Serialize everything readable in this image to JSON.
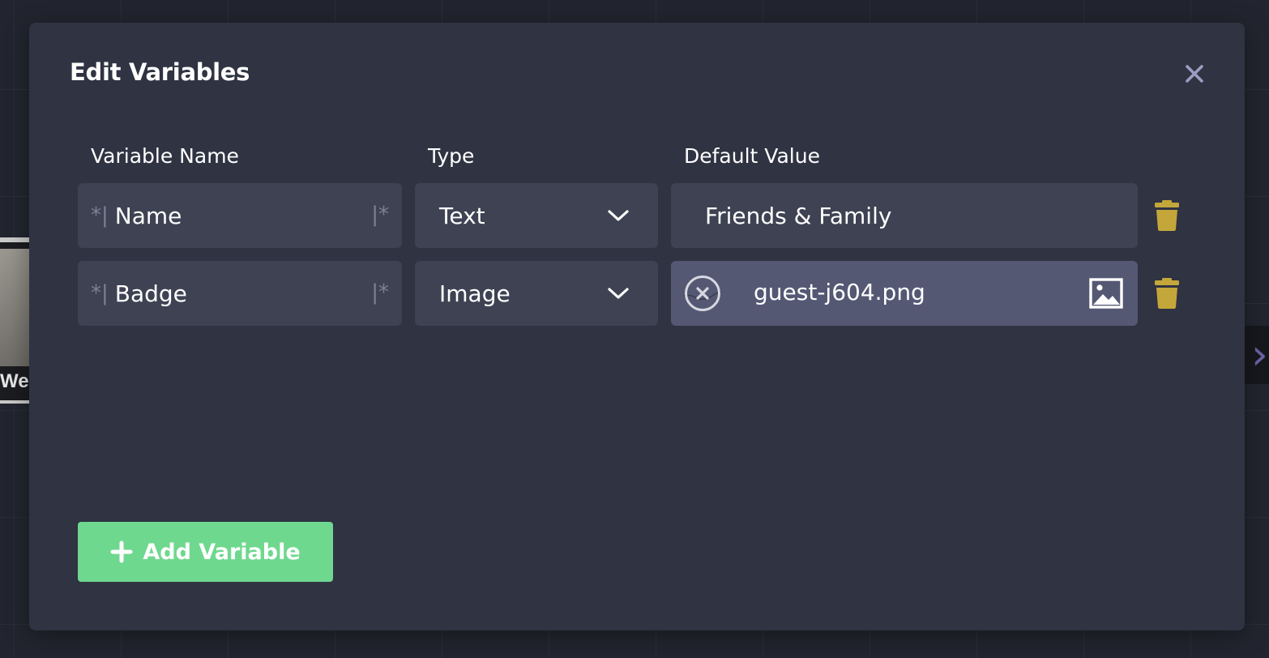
{
  "background": {
    "node_caption": "We",
    "side_arrow": "›"
  },
  "modal": {
    "title": "Edit Variables",
    "close_icon": "close-icon"
  },
  "columns": {
    "name": "Variable Name",
    "type": "Type",
    "default": "Default Value"
  },
  "delimiters": {
    "left": "*|",
    "right": "|*"
  },
  "variables": [
    {
      "name": "Name",
      "type": "Text",
      "default_value": "Friends & Family"
    },
    {
      "name": "Badge",
      "type": "Image",
      "default_value": "guest-j604.png"
    }
  ],
  "add_button": {
    "label": "Add Variable",
    "icon": "plus-icon"
  },
  "colors": {
    "modal_bg": "#2f3342",
    "field_bg": "#3e4252",
    "image_field_bg": "#545873",
    "accent_green": "#6fd88f",
    "trash_gold": "#c4a73a",
    "close_icon": "#9a9ec2"
  }
}
